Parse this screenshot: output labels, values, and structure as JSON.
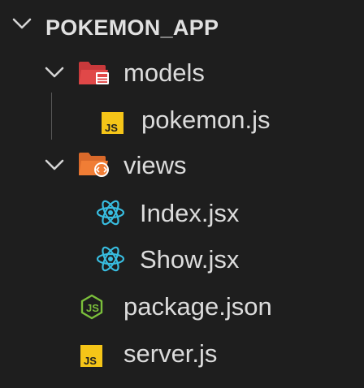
{
  "explorer": {
    "root": {
      "label": "POKEMON_APP",
      "expanded": true,
      "icon": "chevron-down-icon"
    },
    "items": [
      {
        "label": "models",
        "type": "folder",
        "expanded": true,
        "icon": "folder-open-models-icon"
      },
      {
        "label": "pokemon.js",
        "type": "file",
        "icon": "javascript-file-icon"
      },
      {
        "label": "views",
        "type": "folder",
        "expanded": true,
        "icon": "folder-open-views-icon"
      },
      {
        "label": "Index.jsx",
        "type": "file",
        "icon": "react-icon"
      },
      {
        "label": "Show.jsx",
        "type": "file",
        "icon": "react-icon"
      },
      {
        "label": "package.json",
        "type": "file",
        "icon": "nodejs-icon"
      },
      {
        "label": "server.js",
        "type": "file",
        "icon": "javascript-file-icon"
      }
    ]
  },
  "colors": {
    "background": "#1e1e1e",
    "text": "#dcdcdc",
    "models_folder": "#e04848",
    "views_folder": "#f07d35",
    "javascript": "#f5c518",
    "react": "#38bde0",
    "nodejs": "#7bbf3b"
  }
}
